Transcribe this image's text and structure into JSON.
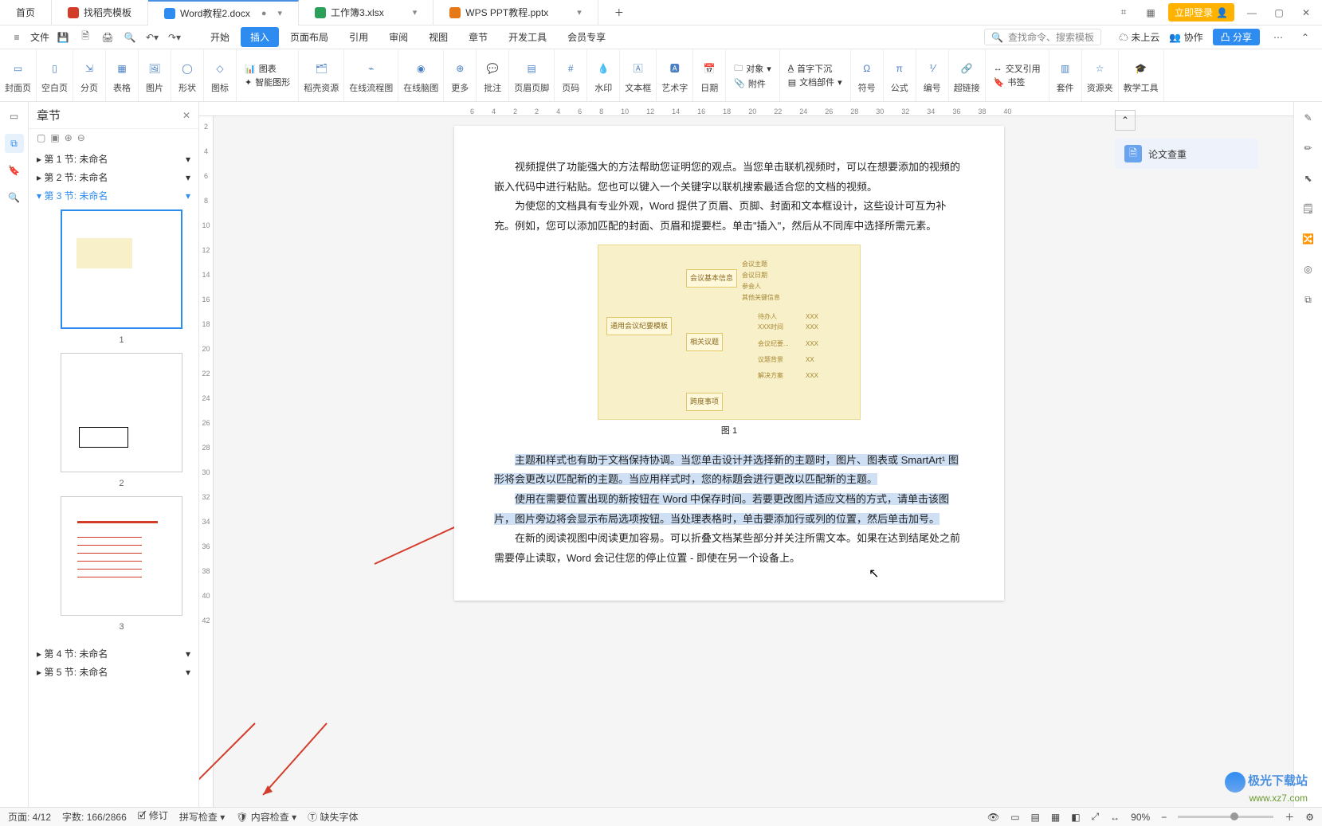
{
  "tabs": {
    "home": "首页",
    "items": [
      {
        "label": "找稻壳模板",
        "color": "#d43c2a",
        "letter": "D"
      },
      {
        "label": "Word教程2.docx",
        "color": "#2e8cf0",
        "letter": "W",
        "active": true
      },
      {
        "label": "工作簿3.xlsx",
        "color": "#2aa05a",
        "letter": "S"
      },
      {
        "label": "WPS PPT教程.pptx",
        "color": "#e67817",
        "letter": "P"
      }
    ],
    "login": "立即登录"
  },
  "qat": {
    "file": "文件"
  },
  "menu": {
    "items": [
      "开始",
      "插入",
      "页面布局",
      "引用",
      "审阅",
      "视图",
      "章节",
      "开发工具",
      "会员专享"
    ],
    "active": 1,
    "search_label": "查找命令、搜索模板",
    "cloud": "未上云",
    "collab": "协作",
    "share": "分享"
  },
  "ribbon": {
    "groups": [
      "封面页",
      "空白页",
      "分页",
      "表格",
      "图片",
      "形状",
      "图标",
      "智能图形",
      "稻壳资源",
      "在线流程图",
      "在线脑图",
      "更多",
      "批注",
      "页眉页脚",
      "页码",
      "水印",
      "文本框",
      "艺术字",
      "日期",
      "符号",
      "公式",
      "编号",
      "超链接",
      "套件",
      "资源夹",
      "教学工具"
    ],
    "chart_label": "图表",
    "obj": "对象",
    "attach": "附件",
    "docparts": "文档部件",
    "dropcap": "首字下沉",
    "crossref": "交叉引用",
    "bookmark": "书签"
  },
  "sidebar": {
    "title": "章节",
    "sections": [
      {
        "label": "第 1 节: 未命名"
      },
      {
        "label": "第 2 节: 未命名"
      },
      {
        "label": "第 3 节: 未命名",
        "active": true
      },
      {
        "label": "第 4 节: 未命名"
      },
      {
        "label": "第 5 节: 未命名"
      }
    ],
    "thumb_nums": [
      "1",
      "2",
      "3"
    ]
  },
  "ruler": {
    "marks": [
      "6",
      "4",
      "2",
      "2",
      "4",
      "6",
      "8",
      "10",
      "12",
      "14",
      "16",
      "18",
      "20",
      "22",
      "24",
      "26",
      "28",
      "30",
      "32",
      "34",
      "36",
      "38",
      "40"
    ],
    "vmarks": [
      "2",
      "4",
      "6",
      "8",
      "10",
      "12",
      "14",
      "16",
      "18",
      "20",
      "22",
      "24",
      "26",
      "28",
      "30",
      "32",
      "34",
      "36",
      "38",
      "40",
      "42"
    ]
  },
  "right_panel": {
    "task": "论文查重"
  },
  "page": {
    "p1": "视频提供了功能强大的方法帮助您证明您的观点。当您单击联机视频时，可以在想要添加的视频的嵌入代码中进行粘贴。您也可以键入一个关键字以联机搜索最适合您的文档的视频。",
    "p2": "为使您的文档具有专业外观，Word 提供了页眉、页脚、封面和文本框设计，这些设计可互为补充。例如，您可以添加匹配的封面、页眉和提要栏。单击\"插入\"，然后从不同库中选择所需元素。",
    "figcap": "图 1",
    "p3": "主题和样式也有助于文档保持协调。当您单击设计并选择新的主题时，图片、图表或 SmartArt¹ 图形将会更改以匹配新的主题。当应用样式时，您的标题会进行更改以匹配新的主题。",
    "p4": "使用在需要位置出现的新按钮在 Word 中保存时间。若要更改图片适应文档的方式，请单击该图片，图片旁边将会显示布局选项按钮。当处理表格时，单击要添加行或列的位置，然后单击加号。",
    "p5": "在新的阅读视图中阅读更加容易。可以折叠文档某些部分并关注所需文本。如果在达到结尾处之前需要停止读取，Word 会记住您的停止位置 - 即使在另一个设备上。"
  },
  "mindmap": {
    "root": "通用会议纪要模板",
    "n1": "会议基本信息",
    "n2": "相关议题",
    "n3": "跨度事项",
    "leaves": [
      "会议主题",
      "会议日期",
      "参会人",
      "其他关键信息",
      "待办人",
      "XXX",
      "XXX时间",
      "XXX",
      "会议纪要...",
      "XXX",
      "议题背景",
      "XX",
      "解决方案",
      "XXX"
    ]
  },
  "status": {
    "page": "页面: 4/12",
    "words": "字数: 166/2866",
    "track": "修订",
    "spell": "拼写检查",
    "content": "内容检查",
    "missing_font": "缺失字体",
    "zoom": "90%"
  },
  "watermark": {
    "brand": "极光下载站",
    "url": "www.xz7.com"
  }
}
